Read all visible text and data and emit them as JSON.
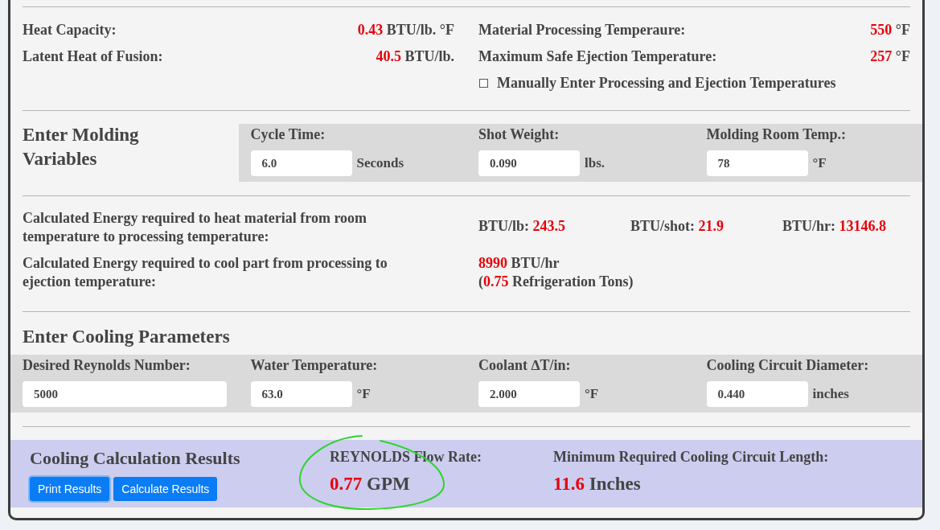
{
  "material_properties": {
    "left": [
      {
        "label": "Heat Capacity:",
        "value": "0.43",
        "unit": "BTU/lb. °F"
      },
      {
        "label": "Latent Heat of Fusion:",
        "value": "40.5",
        "unit": "BTU/lb."
      }
    ],
    "right": [
      {
        "label": "Material Processing Temperaure:",
        "value": "550",
        "unit": "°F"
      },
      {
        "label": "Maximum Safe Ejection Temperature:",
        "value": "257",
        "unit": "°F"
      }
    ],
    "manual_entry": {
      "label": "Manually Enter Processing and Ejection Temperatures",
      "checked": false
    }
  },
  "molding_variables": {
    "heading": "Enter Molding Variables",
    "fields": [
      {
        "label": "Cycle Time:",
        "value": "6.0",
        "unit": "Seconds"
      },
      {
        "label": "Shot Weight:",
        "value": "0.090",
        "unit": "lbs."
      },
      {
        "label": "Molding Room Temp.:",
        "value": "78",
        "unit": "°F"
      }
    ]
  },
  "energy": [
    {
      "label": "Calculated Energy required to heat material from room temperature to processing temperature:",
      "readings": [
        {
          "label": "BTU/lb:",
          "value": "243.5"
        },
        {
          "label": "BTU/shot:",
          "value": "21.9"
        },
        {
          "label": "BTU/hr:",
          "value": "13146.8"
        }
      ]
    },
    {
      "label": "Calculated Energy required to cool part from processing to ejection temperature:",
      "load": {
        "value": "8990",
        "unit": "BTU/hr"
      },
      "tons": {
        "prefix": "(",
        "value": "0.75",
        "unit": "Refrigeration Tons)"
      }
    }
  ],
  "cooling_parameters": {
    "heading": "Enter Cooling Parameters",
    "fields": [
      {
        "label": "Desired Reynolds Number:",
        "value": "5000"
      },
      {
        "label": "Water Temperature:",
        "value": "63.0",
        "unit": "°F"
      },
      {
        "label": "Coolant ∆T/in:",
        "value": "2.000",
        "unit": "°F"
      },
      {
        "label": "Cooling Circuit Diameter:",
        "value": "0.440",
        "unit": "inches"
      }
    ]
  },
  "results": {
    "heading": "Cooling Calculation Results",
    "buttons": [
      {
        "label": "Print Results",
        "focused": true
      },
      {
        "label": "Calculate Results",
        "focused": false
      }
    ],
    "outputs": [
      {
        "label": "REYNOLDS Flow Rate:",
        "value": "0.77",
        "unit": "GPM",
        "circled": true
      },
      {
        "label": "Minimum Required Cooling Circuit Length:",
        "value": "11.6",
        "unit": "Inches",
        "circled": false
      }
    ]
  }
}
